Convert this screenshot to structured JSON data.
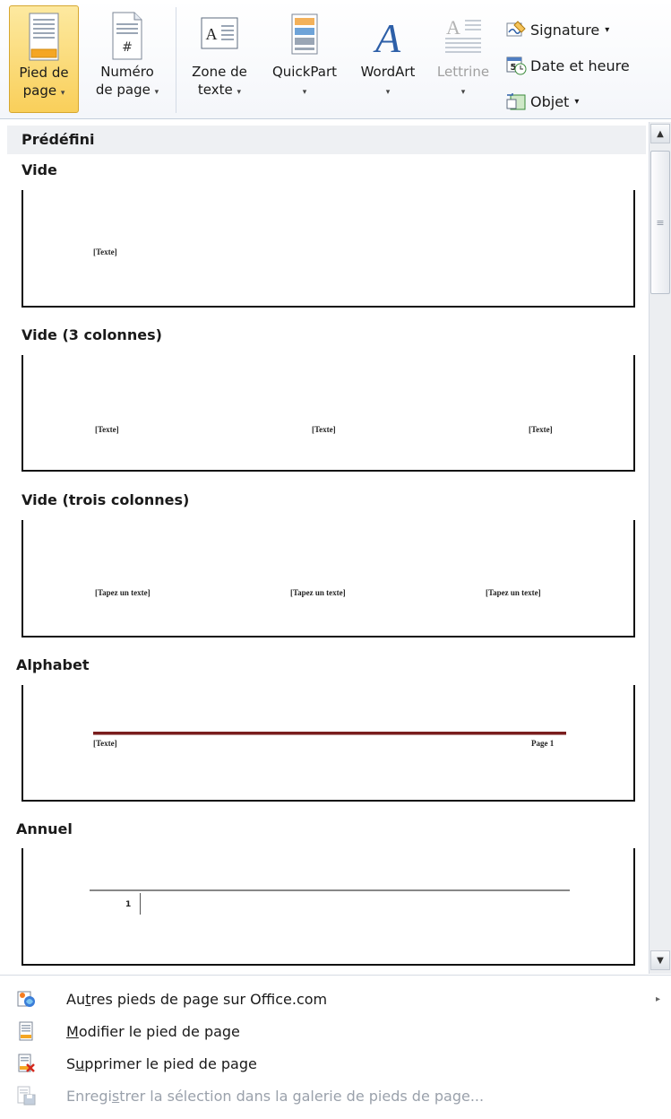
{
  "ribbon": {
    "footer_btn": {
      "line1": "Pied de",
      "line2": "page"
    },
    "page_number_btn": {
      "line1": "Numéro",
      "line2": "de page"
    },
    "textbox_btn": {
      "line1": "Zone de",
      "line2": "texte"
    },
    "quickpart_btn": {
      "line1": "QuickPart"
    },
    "wordart_btn": {
      "line1": "WordArt"
    },
    "dropcap_btn": {
      "line1": "Lettrine"
    },
    "signature_btn": {
      "label": "Signature"
    },
    "datetime_btn": {
      "label": "Date et heure"
    },
    "object_btn": {
      "label": "Objet"
    },
    "dropdown_glyph": "▾"
  },
  "gallery": {
    "header": "Prédéfini",
    "sections": [
      {
        "title": "Vide",
        "labels": [
          "[Texte]"
        ]
      },
      {
        "title": "Vide (3 colonnes)",
        "labels": [
          "[Texte]",
          "[Texte]",
          "[Texte]"
        ]
      },
      {
        "title": "Vide (trois colonnes)",
        "labels": [
          "[Tapez un texte]",
          "[Tapez un texte]",
          "[Tapez un texte]"
        ]
      },
      {
        "title": "Alphabet",
        "labels": [
          "[Texte]",
          "Page 1"
        ]
      },
      {
        "title": "Annuel",
        "labels": [
          "1"
        ]
      }
    ]
  },
  "scrollbar": {
    "up": "▲",
    "down": "▼",
    "grip": "≡"
  },
  "menu": {
    "items": [
      {
        "pre": "Au",
        "accel": "t",
        "post": "res pieds de page sur Office.com",
        "submenu": "▸"
      },
      {
        "pre": "",
        "accel": "M",
        "post": "odifier le pied de page"
      },
      {
        "pre": "S",
        "accel": "u",
        "post": "pprimer le pied de page"
      },
      {
        "pre": "Enregi",
        "accel": "s",
        "post": "trer la sélection dans la galerie de pieds de page..."
      }
    ]
  },
  "colors": {
    "active_button": "#f9cf5a",
    "alphabet_rule": "#7a1d1d",
    "annuel_rule": "#888888"
  }
}
